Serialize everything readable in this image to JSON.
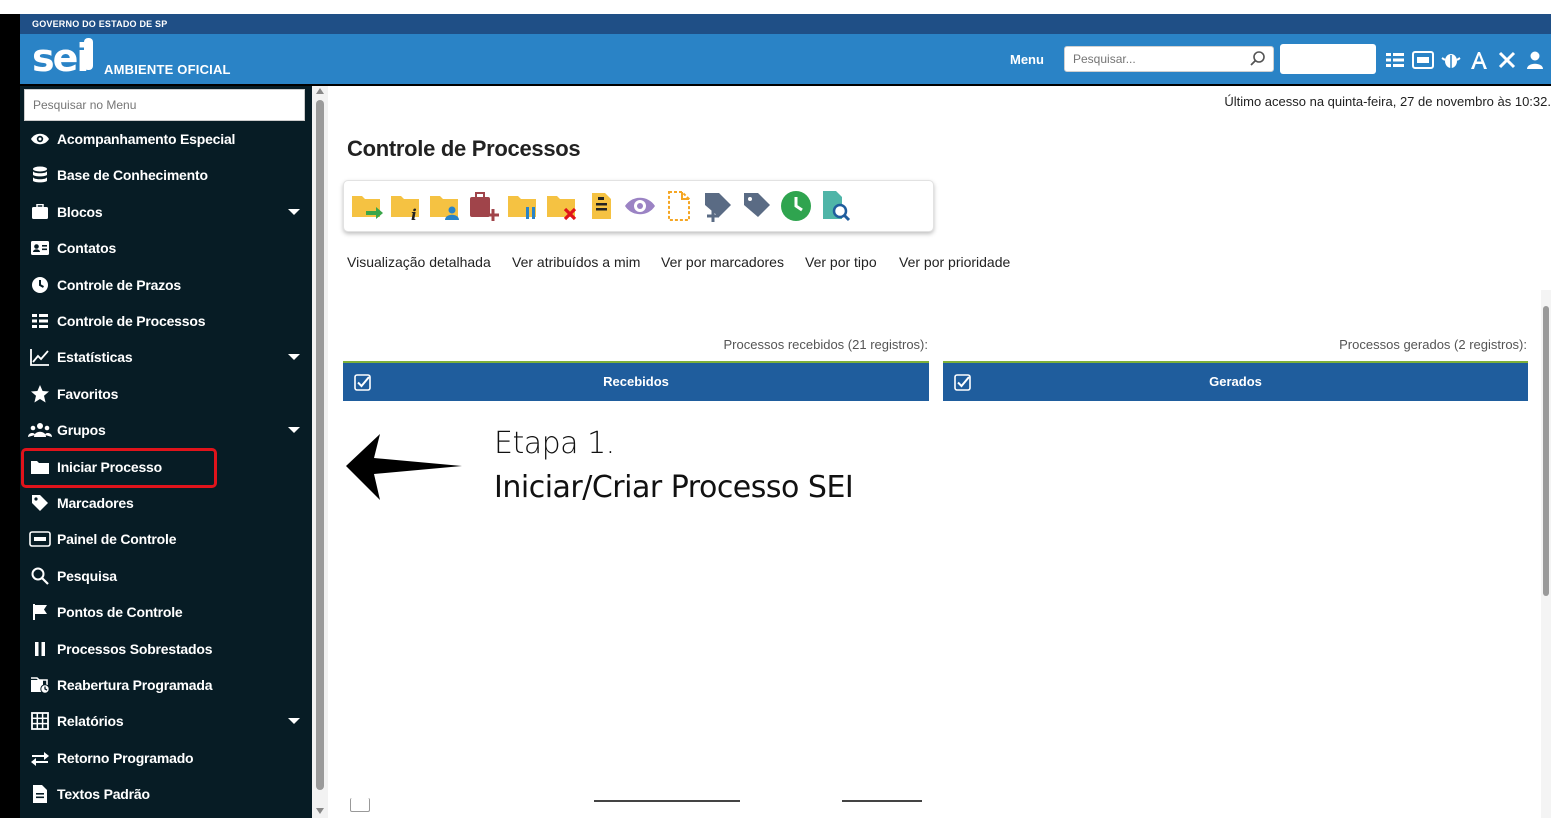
{
  "header": {
    "gov_label": "GOVERNO DO ESTADO DE SP",
    "logo_text": "sei",
    "environment_label": "AMBIENTE OFICIAL",
    "menu_label": "Menu",
    "search_placeholder": "Pesquisar...",
    "icons": [
      "list-icon",
      "calendar-123-icon",
      "bug-icon",
      "font-icon",
      "tools-icon",
      "user-icon",
      "power-icon"
    ]
  },
  "sidebar": {
    "search_placeholder": "Pesquisar no Menu",
    "items": [
      {
        "label": "Acompanhamento Especial",
        "icon": "eye-icon",
        "expandable": false
      },
      {
        "label": "Base de Conhecimento",
        "icon": "database-icon",
        "expandable": false
      },
      {
        "label": "Blocos",
        "icon": "briefcase-icon",
        "expandable": true
      },
      {
        "label": "Contatos",
        "icon": "contact-card-icon",
        "expandable": false
      },
      {
        "label": "Controle de Prazos",
        "icon": "clock-icon",
        "expandable": false
      },
      {
        "label": "Controle de Processos",
        "icon": "list-icon",
        "expandable": false
      },
      {
        "label": "Estatísticas",
        "icon": "line-chart-icon",
        "expandable": true
      },
      {
        "label": "Favoritos",
        "icon": "star-icon",
        "expandable": false
      },
      {
        "label": "Grupos",
        "icon": "users-icon",
        "expandable": true
      },
      {
        "label": "Iniciar Processo",
        "icon": "folder-icon",
        "expandable": false,
        "highlighted": true
      },
      {
        "label": "Marcadores",
        "icon": "tag-icon",
        "expandable": false
      },
      {
        "label": "Painel de Controle",
        "icon": "panel-123-icon",
        "expandable": false
      },
      {
        "label": "Pesquisa",
        "icon": "search-icon",
        "expandable": false
      },
      {
        "label": "Pontos de Controle",
        "icon": "flag-icon",
        "expandable": false
      },
      {
        "label": "Processos Sobrestados",
        "icon": "pause-icon",
        "expandable": false
      },
      {
        "label": "Reabertura Programada",
        "icon": "calendar-reopen-icon",
        "expandable": false
      },
      {
        "label": "Relatórios",
        "icon": "table-icon",
        "expandable": true
      },
      {
        "label": "Retorno Programado",
        "icon": "exchange-icon",
        "expandable": false
      },
      {
        "label": "Textos Padrão",
        "icon": "document-icon",
        "expandable": false
      }
    ],
    "highlight_color": "#e0131b"
  },
  "main": {
    "last_access": "Último acesso na quinta-feira, 27 de novembro às 10:32.",
    "title": "Controle de Processos",
    "toolbar": [
      "folder-send-icon",
      "folder-info-icon",
      "folder-assign-icon",
      "folder-add-block-icon",
      "folder-pause-icon",
      "folder-remove-icon",
      "note-icon",
      "eye-icon",
      "new-document-icon",
      "tag-add-icon",
      "tag-icon",
      "clock-icon",
      "search-document-icon"
    ],
    "view_links": [
      "Visualização detalhada",
      "Ver atribuídos a mim",
      "Ver por marcadores",
      "Ver por tipo",
      "Ver por prioridade"
    ],
    "received_count": "Processos recebidos (21 registros):",
    "generated_count": "Processos gerados (2 registros):",
    "received_header": "Recebidos",
    "generated_header": "Gerados"
  },
  "annotation": {
    "step": "Etapa 1.",
    "description": "Iniciar/Criar Processo SEI"
  },
  "colors": {
    "header_blue": "#2a83c6",
    "gov_strip": "#1f4f86",
    "sidebar_bg": "#071c25",
    "table_header": "#1f5d9d",
    "toolbar_yellow": "#f5c242"
  }
}
